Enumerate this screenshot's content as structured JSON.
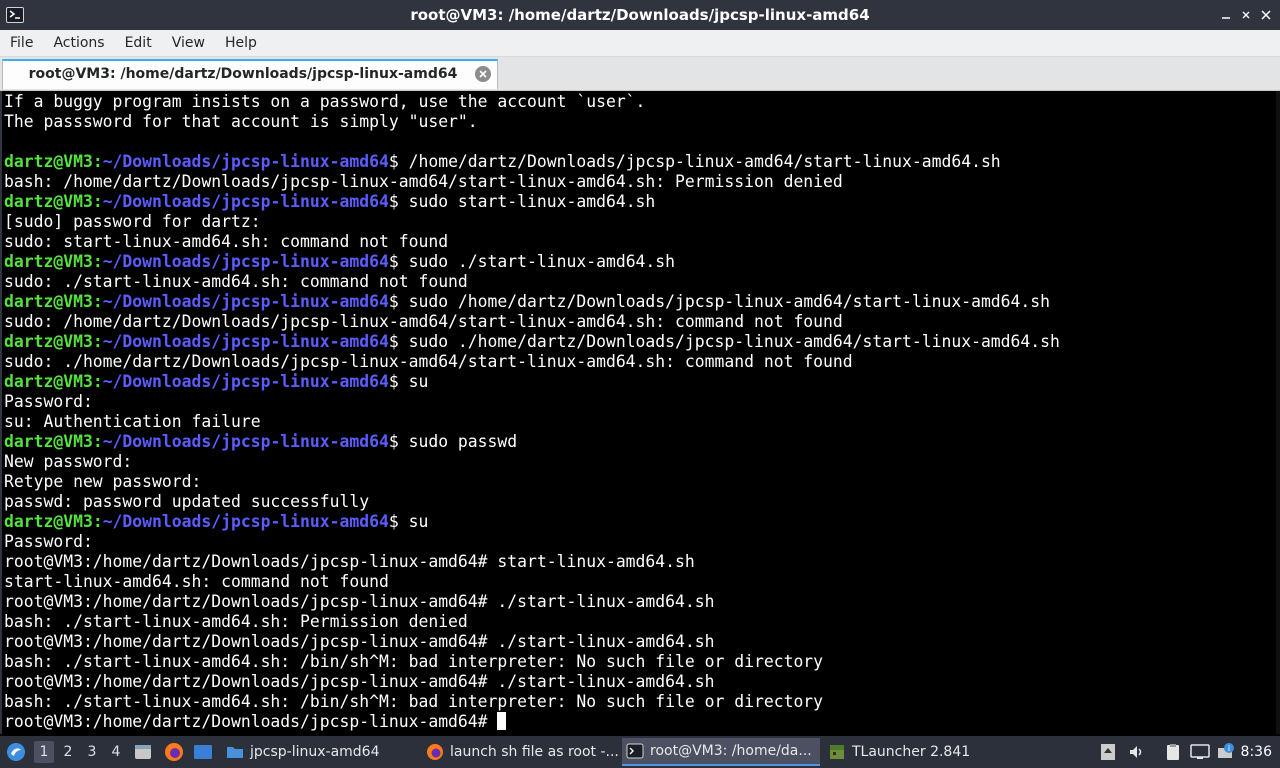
{
  "window": {
    "title": "root@VM3: /home/dartz/Downloads/jpcsp-linux-amd64"
  },
  "menubar": {
    "items": [
      "File",
      "Actions",
      "Edit",
      "View",
      "Help"
    ]
  },
  "tab": {
    "label": "root@VM3: /home/dartz/Downloads/jpcsp-linux-amd64"
  },
  "terminal": {
    "lines": [
      {
        "text": "If a buggy program insists on a password, use the account `user`."
      },
      {
        "text": "The passsword for that account is simply \"user\"."
      },
      {
        "text": ""
      },
      {
        "user": "dartz@VM3",
        "path": "~/Downloads/jpcsp-linux-amd64",
        "cmd": "$ /home/dartz/Downloads/jpcsp-linux-amd64/start-linux-amd64.sh"
      },
      {
        "text": "bash: /home/dartz/Downloads/jpcsp-linux-amd64/start-linux-amd64.sh: Permission denied"
      },
      {
        "user": "dartz@VM3",
        "path": "~/Downloads/jpcsp-linux-amd64",
        "cmd": "$ sudo start-linux-amd64.sh"
      },
      {
        "text": "[sudo] password for dartz:"
      },
      {
        "text": "sudo: start-linux-amd64.sh: command not found"
      },
      {
        "user": "dartz@VM3",
        "path": "~/Downloads/jpcsp-linux-amd64",
        "cmd": "$ sudo ./start-linux-amd64.sh"
      },
      {
        "text": "sudo: ./start-linux-amd64.sh: command not found"
      },
      {
        "user": "dartz@VM3",
        "path": "~/Downloads/jpcsp-linux-amd64",
        "cmd": "$ sudo /home/dartz/Downloads/jpcsp-linux-amd64/start-linux-amd64.sh"
      },
      {
        "text": "sudo: /home/dartz/Downloads/jpcsp-linux-amd64/start-linux-amd64.sh: command not found"
      },
      {
        "user": "dartz@VM3",
        "path": "~/Downloads/jpcsp-linux-amd64",
        "cmd": "$ sudo ./home/dartz/Downloads/jpcsp-linux-amd64/start-linux-amd64.sh"
      },
      {
        "text": "sudo: ./home/dartz/Downloads/jpcsp-linux-amd64/start-linux-amd64.sh: command not found"
      },
      {
        "user": "dartz@VM3",
        "path": "~/Downloads/jpcsp-linux-amd64",
        "cmd": "$ su"
      },
      {
        "text": "Password:"
      },
      {
        "text": "su: Authentication failure"
      },
      {
        "user": "dartz@VM3",
        "path": "~/Downloads/jpcsp-linux-amd64",
        "cmd": "$ sudo passwd"
      },
      {
        "text": "New password:"
      },
      {
        "text": "Retype new password:"
      },
      {
        "text": "passwd: password updated successfully"
      },
      {
        "user": "dartz@VM3",
        "path": "~/Downloads/jpcsp-linux-amd64",
        "cmd": "$ su"
      },
      {
        "text": "Password:"
      },
      {
        "text": "root@VM3:/home/dartz/Downloads/jpcsp-linux-amd64# start-linux-amd64.sh"
      },
      {
        "text": "start-linux-amd64.sh: command not found"
      },
      {
        "text": "root@VM3:/home/dartz/Downloads/jpcsp-linux-amd64# ./start-linux-amd64.sh"
      },
      {
        "text": "bash: ./start-linux-amd64.sh: Permission denied"
      },
      {
        "text": "root@VM3:/home/dartz/Downloads/jpcsp-linux-amd64# ./start-linux-amd64.sh"
      },
      {
        "text": "bash: ./start-linux-amd64.sh: /bin/sh^M: bad interpreter: No such file or directory"
      },
      {
        "text": "root@VM3:/home/dartz/Downloads/jpcsp-linux-amd64# ./start-linux-amd64.sh"
      },
      {
        "text": "bash: ./start-linux-amd64.sh: /bin/sh^M: bad interpreter: No such file or directory"
      },
      {
        "text": "root@VM3:/home/dartz/Downloads/jpcsp-linux-amd64# ",
        "cursor": true
      }
    ]
  },
  "taskbar": {
    "workspaces": [
      "1",
      "2",
      "3",
      "4"
    ],
    "active_workspace": "1",
    "tasks": [
      {
        "label": "jpcsp-linux-amd64",
        "icon": "folder-icon",
        "active": false
      },
      {
        "label": "launch sh file as root -...",
        "icon": "firefox-icon",
        "active": false
      },
      {
        "label": "root@VM3: /home/da...",
        "icon": "terminal-icon",
        "active": true
      },
      {
        "label": "TLauncher 2.841",
        "icon": "tlauncher-icon",
        "active": false
      }
    ],
    "clock": "8:36"
  },
  "colors": {
    "prompt_user": "#54e23c",
    "prompt_path": "#5c5cff",
    "accent": "#5294e2"
  }
}
